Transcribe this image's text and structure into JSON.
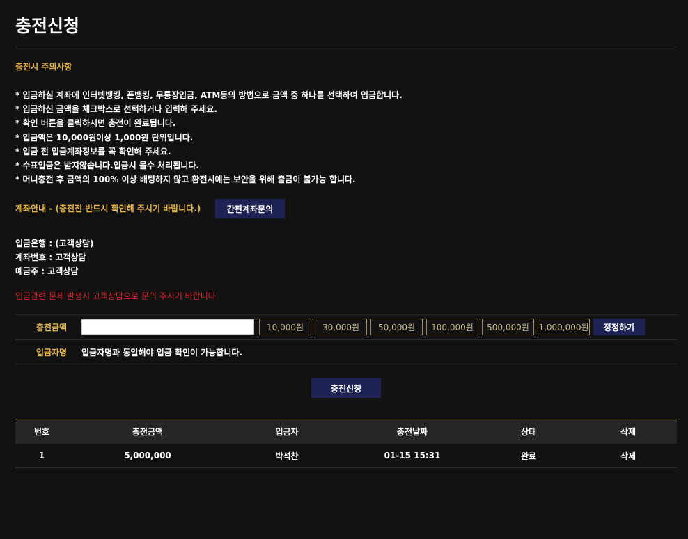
{
  "page": {
    "title": "충전신청"
  },
  "notice": {
    "title": "충전시 주의사항",
    "items": [
      "* 입금하실 계좌에 인터넷뱅킹, 폰뱅킹, 무통장입금, ATM등의 방법으로 금액 중 하나를 선택하여 입금합니다.",
      "* 입금하신 금액을 체크박스로 선택하거나 입력해 주세요.",
      "* 확인 버튼을 클릭하시면 충전이 완료됩니다.",
      "* 입금액은 10,000원이상 1,000원 단위입니다.",
      "* 입금 전 입금계좌정보를 꼭 확인해 주세요.",
      "* 수표입금은 받지않습니다.입금시 몰수 처리됩니다.",
      "* 머니충전 후 금액의 100% 이상 배팅하지 않고 환전시에는 보안을 위해 출금이 불가능 합니다."
    ]
  },
  "account": {
    "guide": "계좌안내 - (충전전 반드시 확인해 주시기 바랍니다.)",
    "inquiry_button": "간편계좌문의",
    "bank": "입금은행 : (고객상담)",
    "number": "계좌번호 : 고객상담",
    "holder": "예금주 : 고객상담",
    "warning": "입금관련 문제 발생시 고객상담으로 문의 주시기 바랍니다."
  },
  "form": {
    "amount_label": "충전금액",
    "amount_value": "",
    "amount_buttons": [
      "10,000원",
      "30,000원",
      "50,000원",
      "100,000원",
      "500,000원",
      "1,000,000원"
    ],
    "reset_button": "정정하기",
    "depositor_label": "입금자명",
    "depositor_text": "입금자명과 동일해야 입금 확인이 가능합니다.",
    "submit_button": "충전신청"
  },
  "history": {
    "columns": [
      "번호",
      "충전금액",
      "입금자",
      "충전날짜",
      "상태",
      "삭제"
    ],
    "rows": [
      {
        "no": "1",
        "amount": "5,000,000",
        "depositor": "박석찬",
        "date": "01-15 15:31",
        "status": "완료",
        "delete": "삭제"
      }
    ]
  },
  "colors": {
    "background": "#121212",
    "accent": "#e6b34a",
    "button": "#1e2255",
    "warning": "#d2232a"
  }
}
